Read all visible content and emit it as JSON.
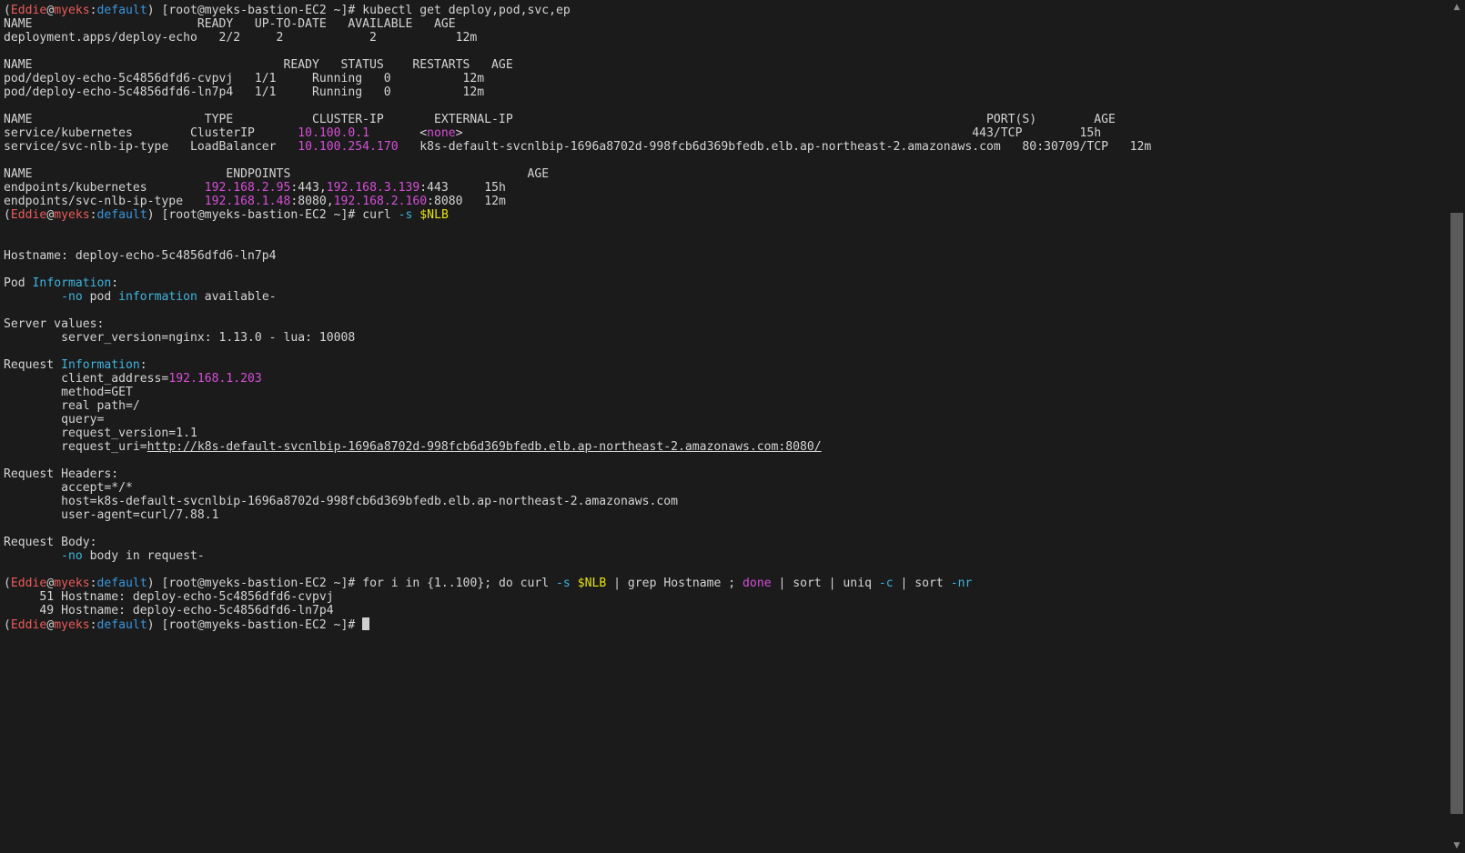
{
  "colors": {
    "background": "#1b1b1b",
    "text": "#d4d4d4",
    "red": "#ea5a5a",
    "magenta": "#d54fd6",
    "cyan": "#3fb3dd",
    "blue": "#3a96dd",
    "yellow": "#e5e510",
    "cursor": "#cfcfcf"
  },
  "icons": {
    "scroll_up": "▲",
    "scroll_down": "▼"
  },
  "scrollbar": {
    "position_fraction": 0.24,
    "visible_fraction": 0.73
  },
  "lines": [
    [
      {
        "t": "("
      },
      {
        "t": "Eddie",
        "c": "red"
      },
      {
        "t": "@"
      },
      {
        "t": "myeks",
        "c": "red"
      },
      {
        "t": ":"
      },
      {
        "t": "default",
        "c": "blue"
      },
      {
        "t": ") [root@myeks-bastion-EC2 ~]# kubectl get deploy,pod,svc,ep"
      }
    ],
    [
      {
        "t": "NAME                       READY   UP-TO-DATE   AVAILABLE   AGE"
      }
    ],
    [
      {
        "t": "deployment.apps/deploy-echo   2/2     2            2           12m"
      }
    ],
    [
      {
        "t": ""
      }
    ],
    [
      {
        "t": "NAME                                   READY   STATUS    RESTARTS   AGE"
      }
    ],
    [
      {
        "t": "pod/deploy-echo-5c4856dfd6-cvpvj   1/1     Running   0          12m"
      }
    ],
    [
      {
        "t": "pod/deploy-echo-5c4856dfd6-ln7p4   1/1     Running   0          12m"
      }
    ],
    [
      {
        "t": ""
      }
    ],
    [
      {
        "t": "NAME                        TYPE           CLUSTER-IP       EXTERNAL-IP                                                                  PORT(S)        AGE"
      }
    ],
    [
      {
        "t": "service/kubernetes        ClusterIP      "
      },
      {
        "t": "10.100.0.1",
        "c": "mag"
      },
      {
        "t": "       "
      },
      {
        "t": "<"
      },
      {
        "t": "none",
        "c": "mag"
      },
      {
        "t": ">                                                                       443/TCP        15h"
      }
    ],
    [
      {
        "t": "service/svc-nlb-ip-type   LoadBalancer   "
      },
      {
        "t": "10.100.254.170",
        "c": "mag"
      },
      {
        "t": "   k8s-default-svcnlbip-1696a8702d-998fcb6d369bfedb.elb.ap-northeast-2.amazonaws.com   80:30709/TCP   12m"
      }
    ],
    [
      {
        "t": ""
      }
    ],
    [
      {
        "t": "NAME                           ENDPOINTS                                 AGE"
      }
    ],
    [
      {
        "t": "endpoints/kubernetes        "
      },
      {
        "t": "192.168.2.95",
        "c": "mag"
      },
      {
        "t": ":443,"
      },
      {
        "t": "192.168.3.139",
        "c": "mag"
      },
      {
        "t": ":443     15h"
      }
    ],
    [
      {
        "t": "endpoints/svc-nlb-ip-type   "
      },
      {
        "t": "192.168.1.48",
        "c": "mag"
      },
      {
        "t": ":8080,"
      },
      {
        "t": "192.168.2.160",
        "c": "mag"
      },
      {
        "t": ":8080   12m"
      }
    ],
    [
      {
        "t": "("
      },
      {
        "t": "Eddie",
        "c": "red"
      },
      {
        "t": "@"
      },
      {
        "t": "myeks",
        "c": "red"
      },
      {
        "t": ":"
      },
      {
        "t": "default",
        "c": "blue"
      },
      {
        "t": ") [root@myeks-bastion-EC2 ~]# curl "
      },
      {
        "t": "-s",
        "c": "cyan"
      },
      {
        "t": " "
      },
      {
        "t": "$NLB",
        "c": "yellow"
      }
    ],
    [
      {
        "t": ""
      }
    ],
    [
      {
        "t": ""
      }
    ],
    [
      {
        "t": "Hostname: deploy-echo-5c4856dfd6-ln7p4"
      }
    ],
    [
      {
        "t": ""
      }
    ],
    [
      {
        "t": "Pod "
      },
      {
        "t": "Information",
        "c": "cyan"
      },
      {
        "t": ":"
      }
    ],
    [
      {
        "t": "        "
      },
      {
        "t": "-no",
        "c": "cyan"
      },
      {
        "t": " pod "
      },
      {
        "t": "information",
        "c": "cyan"
      },
      {
        "t": " available-"
      }
    ],
    [
      {
        "t": ""
      }
    ],
    [
      {
        "t": "Server values:"
      }
    ],
    [
      {
        "t": "        server_version=nginx: 1.13.0 - lua: 10008"
      }
    ],
    [
      {
        "t": ""
      }
    ],
    [
      {
        "t": "Request "
      },
      {
        "t": "Information",
        "c": "cyan"
      },
      {
        "t": ":"
      }
    ],
    [
      {
        "t": "        client_address="
      },
      {
        "t": "192.168.1.203",
        "c": "mag"
      }
    ],
    [
      {
        "t": "        method=GET"
      }
    ],
    [
      {
        "t": "        real path=/"
      }
    ],
    [
      {
        "t": "        query="
      }
    ],
    [
      {
        "t": "        request_version=1.1"
      }
    ],
    [
      {
        "t": "        request_uri="
      },
      {
        "t": "http://k8s-default-svcnlbip-1696a8702d-998fcb6d369bfedb.elb.ap-northeast-2.amazonaws.com:8080/",
        "c": "link"
      }
    ],
    [
      {
        "t": ""
      }
    ],
    [
      {
        "t": "Request Headers:"
      }
    ],
    [
      {
        "t": "        accept=*/*"
      }
    ],
    [
      {
        "t": "        host=k8s-default-svcnlbip-1696a8702d-998fcb6d369bfedb.elb.ap-northeast-2.amazonaws.com"
      }
    ],
    [
      {
        "t": "        user-agent=curl/7.88.1"
      }
    ],
    [
      {
        "t": ""
      }
    ],
    [
      {
        "t": "Request Body:"
      }
    ],
    [
      {
        "t": "        "
      },
      {
        "t": "-no",
        "c": "cyan"
      },
      {
        "t": " body in request-"
      }
    ],
    [
      {
        "t": ""
      }
    ],
    [
      {
        "t": "("
      },
      {
        "t": "Eddie",
        "c": "red"
      },
      {
        "t": "@"
      },
      {
        "t": "myeks",
        "c": "red"
      },
      {
        "t": ":"
      },
      {
        "t": "default",
        "c": "blue"
      },
      {
        "t": ") [root@myeks-bastion-EC2 ~]# for i in {1..100}; do curl "
      },
      {
        "t": "-s",
        "c": "cyan"
      },
      {
        "t": " "
      },
      {
        "t": "$NLB",
        "c": "yellow"
      },
      {
        "t": " | grep Hostname ; "
      },
      {
        "t": "done",
        "c": "mag"
      },
      {
        "t": " | sort | uniq "
      },
      {
        "t": "-c",
        "c": "cyan"
      },
      {
        "t": " | sort "
      },
      {
        "t": "-nr",
        "c": "cyan"
      }
    ],
    [
      {
        "t": "     51 Hostname: deploy-echo-5c4856dfd6-cvpvj"
      }
    ],
    [
      {
        "t": "     49 Hostname: deploy-echo-5c4856dfd6-ln7p4"
      }
    ],
    [
      {
        "t": "("
      },
      {
        "t": "Eddie",
        "c": "red"
      },
      {
        "t": "@"
      },
      {
        "t": "myeks",
        "c": "red"
      },
      {
        "t": ":"
      },
      {
        "t": "default",
        "c": "blue"
      },
      {
        "t": ") [root@myeks-bastion-EC2 ~]# "
      },
      {
        "t": "",
        "cursor": true
      }
    ]
  ]
}
